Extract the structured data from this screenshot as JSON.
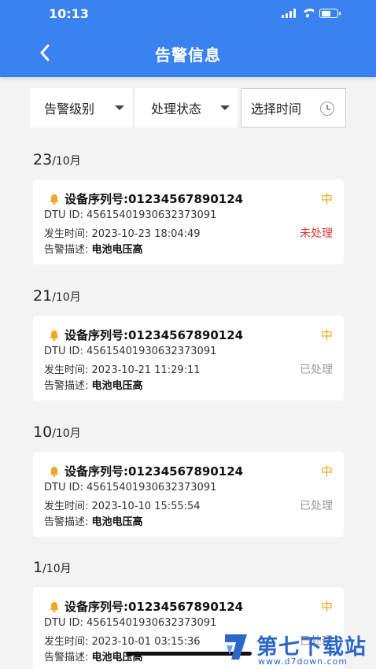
{
  "status_bar": {
    "time": "10:13"
  },
  "nav": {
    "title": "告警信息"
  },
  "filters": {
    "level": "告警级别",
    "status": "处理状态",
    "time": "选择时间"
  },
  "groups": [
    {
      "day": "23",
      "month": "/10月",
      "card": {
        "serial": "设备序列号:01234567890124",
        "dtu": "DTU ID: 45615401930632373091",
        "time": "发生时间: 2023-10-23 18:04:49",
        "desc_label": "告警描述: ",
        "desc": "电池电压高",
        "level": "中",
        "status": "未处理"
      }
    },
    {
      "day": "21",
      "month": "/10月",
      "card": {
        "serial": "设备序列号:01234567890124",
        "dtu": "DTU ID: 45615401930632373091",
        "time": "发生时间: 2023-10-21 11:29:11",
        "desc_label": "告警描述: ",
        "desc": "电池电压高",
        "level": "中",
        "status": "已处理"
      }
    },
    {
      "day": "10",
      "month": "/10月",
      "card": {
        "serial": "设备序列号:01234567890124",
        "dtu": "DTU ID: 45615401930632373091",
        "time": "发生时间: 2023-10-10 15:55:54",
        "desc_label": "告警描述: ",
        "desc": "电池电压高",
        "level": "中",
        "status": "已处理"
      }
    },
    {
      "day": "1",
      "month": "/10月",
      "card": {
        "serial": "设备序列号:01234567890124",
        "dtu": "DTU ID: 45615401930632373091",
        "time": "发生时间: 2023-10-01 03:15:36",
        "desc_label": "告警描述: ",
        "desc": "电池电压高",
        "level": "中",
        "status": "已处理"
      }
    }
  ],
  "colors": {
    "primary": "#3a82f0",
    "level_medium": "#f0a81c",
    "status_open": "#d23b2b",
    "status_done": "#999999"
  },
  "watermark": {
    "text": "第七下载站",
    "url": "www.d7down.com"
  }
}
